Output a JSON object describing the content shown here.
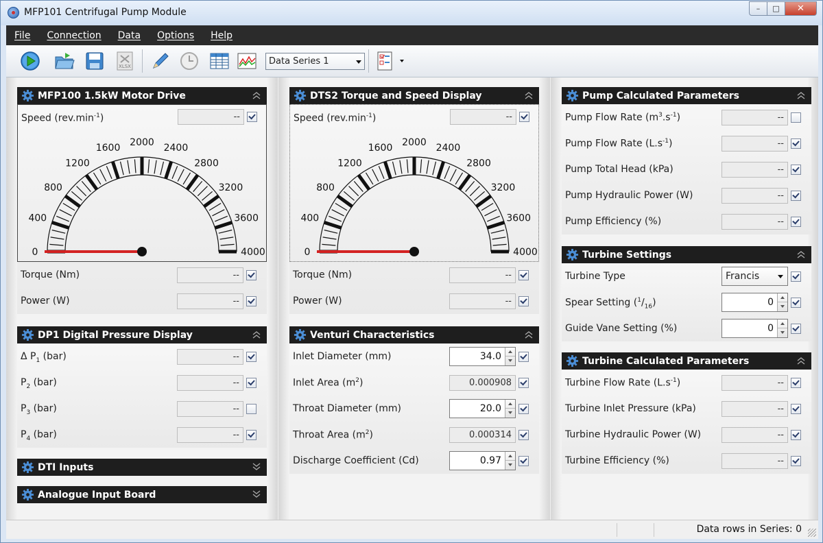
{
  "window": {
    "title": "MFP101 Centrifugal Pump Module",
    "min": "–",
    "max": "□",
    "close": "✕"
  },
  "menu": [
    "File",
    "Connection",
    "Data",
    "Options",
    "Help"
  ],
  "toolbar": {
    "series_select": "Data Series 1",
    "icons": [
      "play-icon",
      "open-folder-icon",
      "save-icon",
      "export-xlsx-icon",
      "pencil-icon",
      "clock-icon",
      "table-icon",
      "chart-icon",
      "report-icon"
    ]
  },
  "colors": {
    "header": "#1e1e1e",
    "needle": "#d32222",
    "accent": "#2a64b6"
  },
  "gauge": {
    "min": 0,
    "max": 4000,
    "value": 0,
    "ticks": [
      "0",
      "400",
      "800",
      "1200",
      "1600",
      "2000",
      "2400",
      "2800",
      "3200",
      "3600",
      "4000"
    ]
  },
  "motor": {
    "title": "MFP100 1.5kW Motor Drive",
    "rows": [
      {
        "label": "Speed  (rev.min",
        "sup": "-1",
        "tail": ")",
        "value": "--",
        "checked": true
      },
      {
        "label": "Torque  (Nm)",
        "value": "--",
        "checked": true
      },
      {
        "label": "Power  (W)",
        "value": "--",
        "checked": true
      }
    ]
  },
  "pressure": {
    "title": "DP1 Digital Pressure Display",
    "rows": [
      {
        "label": "Δ P",
        "sub": "1",
        "tail": "  (bar)",
        "value": "--",
        "checked": true
      },
      {
        "label": "P",
        "sub": "2",
        "tail": "  (bar)",
        "value": "--",
        "checked": true
      },
      {
        "label": "P",
        "sub": "3",
        "tail": "  (bar)",
        "value": "--",
        "checked": false
      },
      {
        "label": "P",
        "sub": "4",
        "tail": "  (bar)",
        "value": "--",
        "checked": true
      }
    ]
  },
  "dti": {
    "title": "DTI Inputs"
  },
  "analogue": {
    "title": "Analogue Input Board"
  },
  "dts": {
    "title": "DTS2 Torque and Speed Display",
    "rows": [
      {
        "label": "Speed  (rev.min",
        "sup": "-1",
        "tail": ")",
        "value": "--",
        "checked": true
      },
      {
        "label": "Torque  (Nm)",
        "value": "--",
        "checked": true
      },
      {
        "label": "Power  (W)",
        "value": "--",
        "checked": true
      }
    ]
  },
  "venturi": {
    "title": "Venturi Characteristics",
    "rows": [
      {
        "label": "Inlet Diameter  (mm)",
        "value": "34.0",
        "kind": "edit",
        "checked": true
      },
      {
        "label": "Inlet Area  (m",
        "sup": "2",
        "tail": ")",
        "value": "0.000908",
        "kind": "ro",
        "checked": true
      },
      {
        "label": "Throat Diameter  (mm)",
        "value": "20.0",
        "kind": "edit",
        "checked": true
      },
      {
        "label": "Throat Area  (m",
        "sup": "2",
        "tail": ")",
        "value": "0.000314",
        "kind": "ro",
        "checked": true
      },
      {
        "label": "Discharge Coefficient  (Cd)",
        "value": "0.97",
        "kind": "edit",
        "checked": true
      }
    ]
  },
  "pump": {
    "title": "Pump Calculated Parameters",
    "rows": [
      {
        "label": "Pump Flow Rate  (m",
        "sup": "3",
        "mid": ".s",
        "sup2": "-1",
        "tail": ")",
        "value": "--",
        "checked": false
      },
      {
        "label": "Pump Flow Rate  (L.s",
        "sup": "-1",
        "tail": ")",
        "value": "--",
        "checked": true
      },
      {
        "label": "Pump Total Head  (kPa)",
        "value": "--",
        "checked": true
      },
      {
        "label": "Pump Hydraulic Power  (W)",
        "value": "--",
        "checked": true
      },
      {
        "label": "Pump Efficiency  (%)",
        "value": "--",
        "checked": true
      }
    ]
  },
  "turbine_settings": {
    "title": "Turbine Settings",
    "rows": [
      {
        "label": "Turbine Type",
        "value": "Francis",
        "kind": "select",
        "checked": true
      },
      {
        "label": "Spear Setting  (",
        "sup": "1",
        "mid": "/",
        "sub": "16",
        "tail": ")",
        "value": "0",
        "kind": "edit",
        "checked": true
      },
      {
        "label": "Guide Vane Setting  (%)",
        "value": "0",
        "kind": "edit",
        "checked": true
      }
    ]
  },
  "turbine_calc": {
    "title": "Turbine Calculated Parameters",
    "rows": [
      {
        "label": "Turbine Flow Rate  (L.s",
        "sup": "-1",
        "tail": ")",
        "value": "--",
        "checked": true
      },
      {
        "label": "Turbine Inlet Pressure  (kPa)",
        "value": "--",
        "checked": true
      },
      {
        "label": "Turbine Hydraulic Power  (W)",
        "value": "--",
        "checked": true
      },
      {
        "label": "Turbine Efficiency  (%)",
        "value": "--",
        "checked": true
      }
    ]
  },
  "status": {
    "text": "Data rows in Series: 0"
  }
}
